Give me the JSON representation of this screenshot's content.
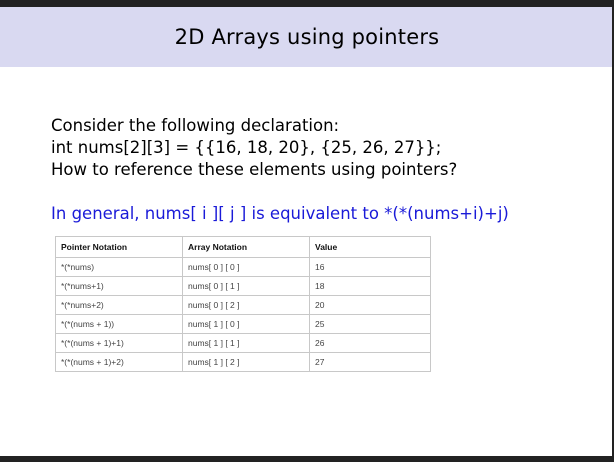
{
  "slide": {
    "title": "2D Arrays using pointers",
    "line1": "Consider the following declaration:",
    "line2": "int nums[2][3] = {{16, 18, 20}, {25, 26, 27}};",
    "line3": "How to reference these elements using pointers?",
    "general": "In general, nums[ i ][ j ] is equivalent to *(*(nums+i)+j)"
  },
  "table": {
    "headers": [
      "Pointer Notation",
      "Array Notation",
      "Value"
    ],
    "rows": [
      [
        "*(*nums)",
        "nums[ 0 ] [ 0 ]",
        "16"
      ],
      [
        "*(*nums+1)",
        "nums[ 0 ] [ 1 ]",
        "18"
      ],
      [
        "*(*nums+2)",
        "nums[ 0 ] [ 2 ]",
        "20"
      ],
      [
        "*(*(nums + 1))",
        "nums[ 1 ] [ 0 ]",
        "25"
      ],
      [
        "*(*(nums + 1)+1)",
        "nums[ 1 ] [ 1 ]",
        "26"
      ],
      [
        "*(*(nums + 1)+2)",
        "nums[ 1 ] [ 2 ]",
        "27"
      ]
    ]
  },
  "colors": {
    "header_bg": "#d9d9f1",
    "accent_text": "#1a1ad8",
    "frame": "#222222"
  }
}
